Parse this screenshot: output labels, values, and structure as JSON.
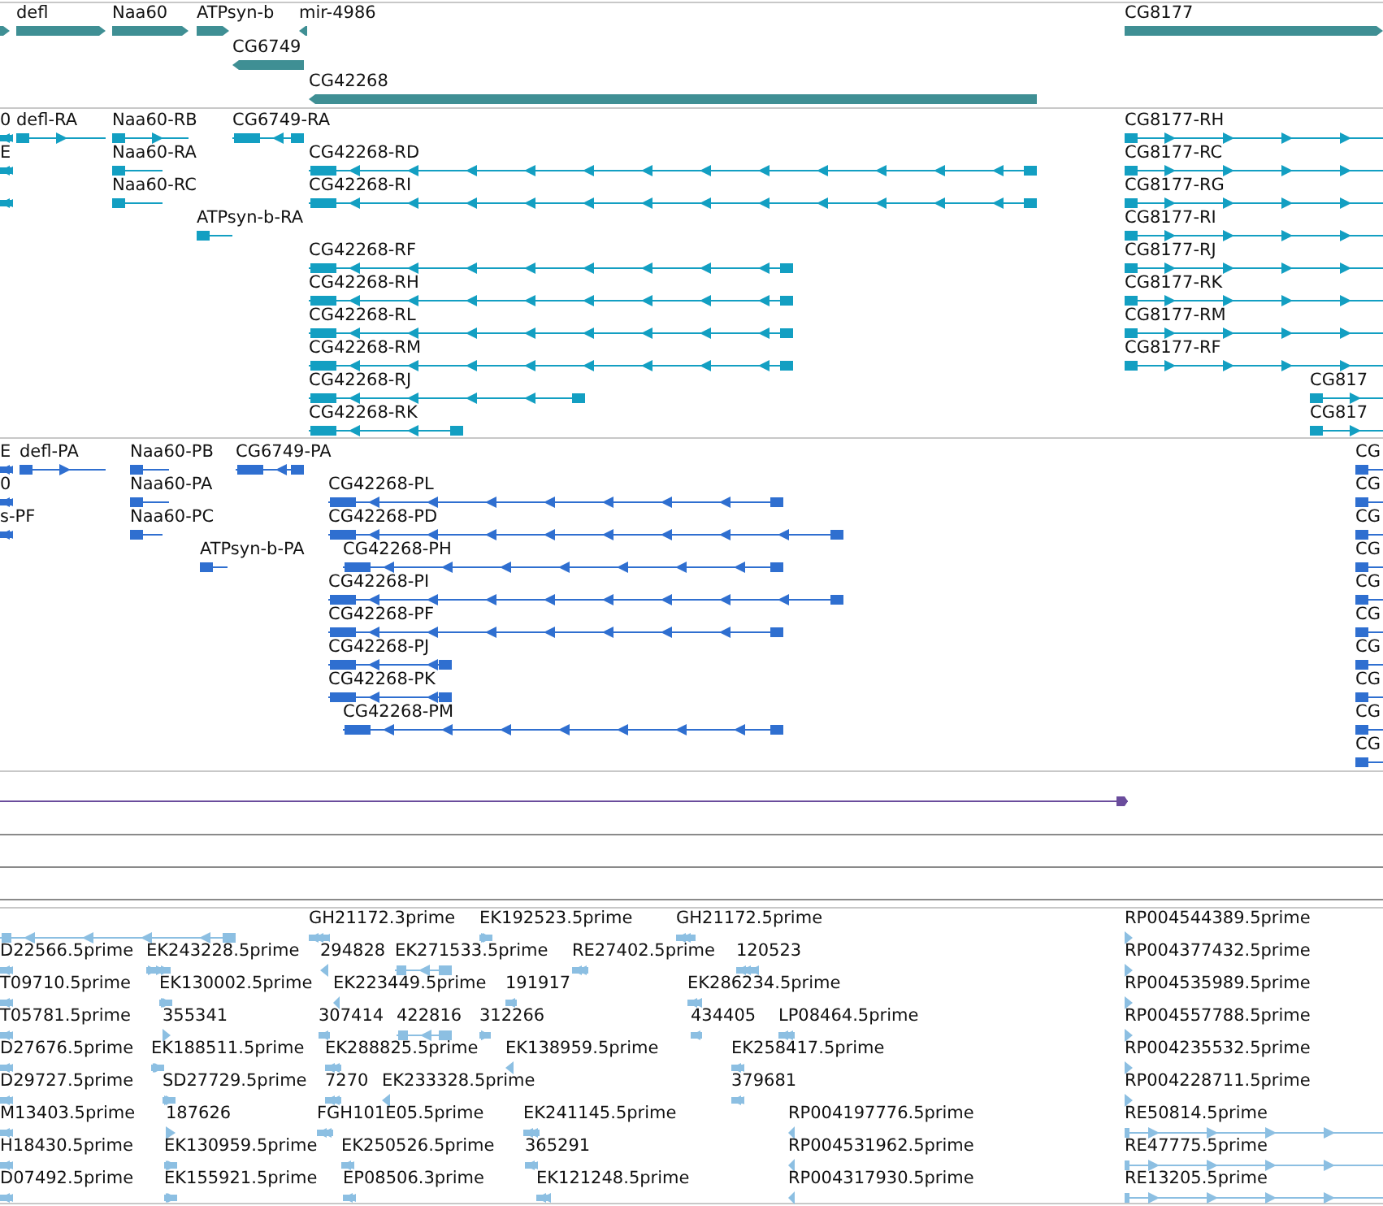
{
  "tracks": [
    {
      "kind": "gene",
      "features": [
        {
          "reverse_strand": false
        },
        {
          "label": "defl",
          "reverse_strand": false
        },
        {
          "label": "Naa60",
          "reverse_strand": false
        },
        {
          "label": "ATPsyn-b",
          "reverse_strand": false
        },
        {
          "label": "mir-4986",
          "reverse_strand": true
        },
        {
          "label": "CG8177",
          "reverse_strand": false
        },
        {
          "label": "CG6749",
          "reverse_strand": true
        },
        {
          "label": "CG42268",
          "reverse_strand": true
        }
      ]
    },
    {
      "kind": "transcript",
      "features": [
        {
          "label": "0",
          "reverse_strand": true
        },
        {
          "label": "defl-RA",
          "reverse_strand": false
        },
        {
          "label": "Naa60-RB",
          "reverse_strand": false
        },
        {
          "label": "CG6749-RA",
          "reverse_strand": true
        },
        {
          "label": "CG8177-RH",
          "reverse_strand": false
        },
        {
          "label": "E",
          "reverse_strand": true
        },
        {
          "label": "Naa60-RA",
          "reverse_strand": false
        },
        {
          "label": "CG42268-RD",
          "reverse_strand": true
        },
        {
          "label": "CG8177-RC",
          "reverse_strand": false
        },
        {
          "reverse_strand": true
        },
        {
          "label": "Naa60-RC",
          "reverse_strand": false
        },
        {
          "label": "CG42268-RI",
          "reverse_strand": true
        },
        {
          "label": "CG8177-RG",
          "reverse_strand": false
        },
        {
          "label": "ATPsyn-b-RA",
          "reverse_strand": false
        },
        {
          "label": "CG8177-RI",
          "reverse_strand": false
        },
        {
          "label": "CG42268-RF",
          "reverse_strand": true
        },
        {
          "label": "CG8177-RJ",
          "reverse_strand": false
        },
        {
          "label": "CG42268-RH",
          "reverse_strand": true
        },
        {
          "label": "CG8177-RK",
          "reverse_strand": false
        },
        {
          "label": "CG42268-RL",
          "reverse_strand": true
        },
        {
          "label": "CG8177-RM",
          "reverse_strand": false
        },
        {
          "label": "CG42268-RM",
          "reverse_strand": true
        },
        {
          "label": "CG8177-RF",
          "reverse_strand": false
        },
        {
          "label": "CG42268-RJ",
          "reverse_strand": true
        },
        {
          "label": "CG817",
          "reverse_strand": false
        },
        {
          "label": "CG42268-RK",
          "reverse_strand": true
        },
        {
          "label": "CG817",
          "reverse_strand": false
        }
      ]
    },
    {
      "kind": "protein",
      "features": [
        {
          "label": "E",
          "reverse_strand": true
        },
        {
          "label": "defl-PA",
          "reverse_strand": false
        },
        {
          "label": "Naa60-PB",
          "reverse_strand": false
        },
        {
          "label": "CG6749-PA",
          "reverse_strand": true
        },
        {
          "label": "CG",
          "reverse_strand": false
        },
        {
          "label": "0",
          "reverse_strand": true
        },
        {
          "label": "Naa60-PA",
          "reverse_strand": false
        },
        {
          "label": "CG42268-PL",
          "reverse_strand": true
        },
        {
          "label": "CG",
          "reverse_strand": false
        },
        {
          "label": "s-PF",
          "reverse_strand": true
        },
        {
          "label": "Naa60-PC",
          "reverse_strand": false
        },
        {
          "label": "CG42268-PD",
          "reverse_strand": true
        },
        {
          "label": "CG",
          "reverse_strand": false
        },
        {
          "label": "ATPsyn-b-PA",
          "reverse_strand": false
        },
        {
          "label": "CG42268-PH",
          "reverse_strand": true
        },
        {
          "label": "CG",
          "reverse_strand": false
        },
        {
          "label": "CG42268-PI",
          "reverse_strand": true
        },
        {
          "label": "CG",
          "reverse_strand": false
        },
        {
          "label": "CG42268-PF",
          "reverse_strand": true
        },
        {
          "label": "CG",
          "reverse_strand": false
        },
        {
          "label": "CG42268-PJ",
          "reverse_strand": true
        },
        {
          "label": "CG",
          "reverse_strand": false
        },
        {
          "label": "CG42268-PK",
          "reverse_strand": true
        },
        {
          "label": "CG",
          "reverse_strand": false
        },
        {
          "label": "CG42268-PM",
          "reverse_strand": true
        },
        {
          "label": "CG",
          "reverse_strand": false
        },
        {
          "label": "CG",
          "reverse_strand": false
        }
      ]
    },
    {
      "kind": "match",
      "features": [
        {
          "reverse_strand": false
        }
      ]
    },
    {
      "kind": "est",
      "features": [
        {
          "reverse_strand": true
        },
        {
          "label": "GH21172.3prime",
          "reverse_strand": true
        },
        {
          "label": "EK192523.5prime",
          "reverse_strand": false
        },
        {
          "label": "GH21172.5prime",
          "reverse_strand": true
        },
        {
          "label": "RP004544389.5prime",
          "reverse_strand": false
        },
        {
          "label": "D22566.5prime",
          "reverse_strand": true
        },
        {
          "label": "EK243228.5prime",
          "reverse_strand": false
        },
        {
          "label": "294828",
          "reverse_strand": true
        },
        {
          "label": "EK271533.5prime",
          "reverse_strand": true
        },
        {
          "label": "RE27402.5prime",
          "reverse_strand": true
        },
        {
          "label": "120523",
          "reverse_strand": true
        },
        {
          "label": "RP004377432.5prime",
          "reverse_strand": false
        },
        {
          "label": "T09710.5prime",
          "reverse_strand": true
        },
        {
          "label": "EK130002.5prime",
          "reverse_strand": false
        },
        {
          "label": "EK223449.5prime",
          "reverse_strand": true
        },
        {
          "label": "191917",
          "reverse_strand": true
        },
        {
          "label": "EK286234.5prime",
          "reverse_strand": true
        },
        {
          "label": "RP004535989.5prime",
          "reverse_strand": false
        },
        {
          "label": "T05781.5prime",
          "reverse_strand": true
        },
        {
          "label": "355341",
          "reverse_strand": false
        },
        {
          "label": "307414",
          "reverse_strand": true
        },
        {
          "label": "422816",
          "reverse_strand": true
        },
        {
          "label": "312266",
          "reverse_strand": false
        },
        {
          "label": "434405",
          "reverse_strand": true
        },
        {
          "label": "LP08464.5prime",
          "reverse_strand": true
        },
        {
          "label": "RP004557788.5prime",
          "reverse_strand": false
        },
        {
          "label": "D27676.5prime",
          "reverse_strand": true
        },
        {
          "label": "EK188511.5prime",
          "reverse_strand": false
        },
        {
          "label": "EK288825.5prime",
          "reverse_strand": true
        },
        {
          "label": "EK138959.5prime",
          "reverse_strand": true
        },
        {
          "label": "EK258417.5prime",
          "reverse_strand": true
        },
        {
          "label": "RP004235532.5prime",
          "reverse_strand": false
        },
        {
          "label": "D29727.5prime",
          "reverse_strand": true
        },
        {
          "label": "SD27729.5prime",
          "reverse_strand": false
        },
        {
          "label": "7270",
          "reverse_strand": true
        },
        {
          "label": "EK233328.5prime",
          "reverse_strand": true
        },
        {
          "label": "379681",
          "reverse_strand": true
        },
        {
          "label": "RP004228711.5prime",
          "reverse_strand": false
        },
        {
          "label": "M13403.5prime",
          "reverse_strand": true
        },
        {
          "label": "187626",
          "reverse_strand": false
        },
        {
          "label": "FGH101E05.5prime",
          "reverse_strand": true
        },
        {
          "label": "EK241145.5prime",
          "reverse_strand": true
        },
        {
          "label": "RP004197776.5prime",
          "reverse_strand": true
        },
        {
          "label": "RE50814.5prime",
          "reverse_strand": false
        },
        {
          "label": "H18430.5prime",
          "reverse_strand": true
        },
        {
          "label": "EK130959.5prime",
          "reverse_strand": false
        },
        {
          "label": "EK250526.5prime",
          "reverse_strand": true
        },
        {
          "label": "365291",
          "reverse_strand": true
        },
        {
          "label": "RP004531962.5prime",
          "reverse_strand": true
        },
        {
          "label": "RE47775.5prime",
          "reverse_strand": false
        },
        {
          "label": "D07492.5prime",
          "reverse_strand": true
        },
        {
          "label": "EK155921.5prime",
          "reverse_strand": false
        },
        {
          "label": "EP08506.3prime",
          "reverse_strand": true
        },
        {
          "label": "EK121248.5prime",
          "reverse_strand": true
        },
        {
          "label": "RP004317930.5prime",
          "reverse_strand": true
        },
        {
          "label": "RE13205.5prime",
          "reverse_strand": false
        }
      ]
    }
  ]
}
